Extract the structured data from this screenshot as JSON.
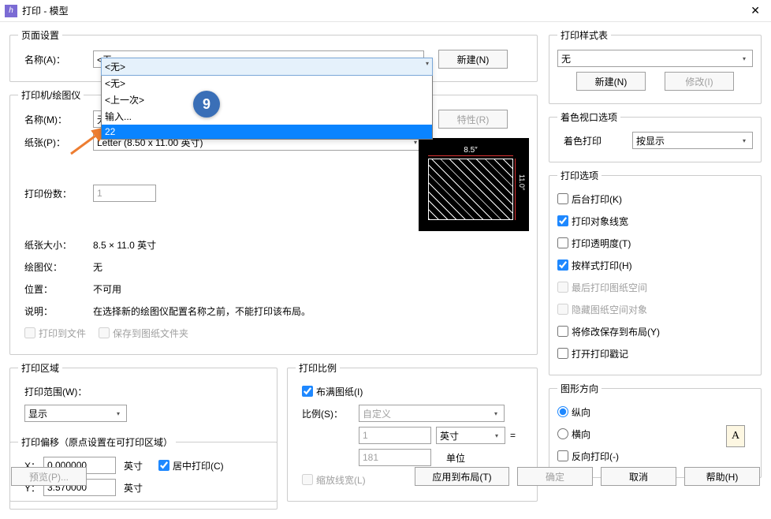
{
  "window": {
    "title": "打印 - 模型"
  },
  "pageSetup": {
    "legend": "页面设置",
    "name_label": "名称(A)：",
    "name_value": "<无>",
    "options": [
      "<无>",
      "<上一次>",
      "输入...",
      "22"
    ],
    "new_btn": "新建(N)"
  },
  "printer": {
    "legend": "打印机/绘图仪",
    "name_label": "名称(M)：",
    "name_value": "无",
    "paper_label": "纸张(P)：",
    "paper_value": "Letter (8.50 x 11.00 英寸)",
    "copies_label": "打印份数：",
    "copies_value": "1",
    "size_label": "纸张大小：",
    "size_value": "8.5 × 11.0  英寸",
    "plotter_label": "绘图仪：",
    "plotter_value": "无",
    "location_label": "位置：",
    "location_value": "不可用",
    "desc_label": "说明：",
    "desc_value": "在选择新的绘图仪配置名称之前，不能打印该布局。",
    "print_to_file": "打印到文件",
    "save_to_sheet": "保存到图纸文件夹",
    "properties_btn": "特性(R)",
    "preview": {
      "w": "8.5″",
      "h": "11.0″"
    }
  },
  "area": {
    "legend": "打印区域",
    "range_label": "打印范围(W)：",
    "range_value": "显示"
  },
  "scale": {
    "legend": "打印比例",
    "fit": "布满图纸(I)",
    "ratio_label": "比例(S)：",
    "ratio_value": "自定义",
    "num": "1",
    "unit_value": "英寸",
    "eq": "=",
    "den": "181",
    "den_unit": "单位",
    "scale_lw": "缩放线宽(L)"
  },
  "offset": {
    "legend": "打印偏移（原点设置在可打印区域）",
    "x_label": "X：",
    "x_value": "0.000000",
    "y_label": "Y：",
    "y_value": "3.570000",
    "unit": "英寸",
    "center": "居中打印(C)"
  },
  "styleTable": {
    "legend": "打印样式表",
    "value": "无",
    "new_btn": "新建(N)",
    "modify_btn": "修改(I)"
  },
  "shaded": {
    "legend": "着色视口选项",
    "label": "着色打印",
    "value": "按显示"
  },
  "options": {
    "legend": "打印选项",
    "bg": "后台打印(K)",
    "lw": "打印对象线宽",
    "transp": "打印透明度(T)",
    "style": "按样式打印(H)",
    "last": "最后打印图纸空间",
    "hide": "隐藏图纸空间对象",
    "save": "将修改保存到布局(Y)",
    "stamp": "打开打印戳记"
  },
  "orient": {
    "legend": "图形方向",
    "portrait": "纵向",
    "landscape": "横向",
    "reverse": "反向打印(-)"
  },
  "footer": {
    "preview": "预览(P)...",
    "apply": "应用到布局(T)",
    "ok": "确定",
    "cancel": "取消",
    "help": "帮助(H)"
  },
  "annotation": {
    "badge": "9"
  }
}
